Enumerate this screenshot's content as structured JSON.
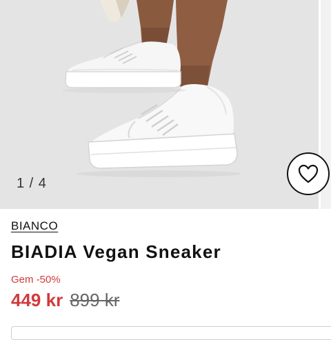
{
  "gallery": {
    "counter": "1 / 4",
    "image_alt": "White vegan leather sneakers worn on feet",
    "wishlist_icon": "heart-outline-icon"
  },
  "product": {
    "brand": "BIANCO",
    "title": "BIADIA Vegan Sneaker",
    "discount": "Gem -50%",
    "sale_price": "449 kr",
    "original_price": "899 kr"
  },
  "colors": {
    "sale": "#d23a3a",
    "image_background": "#e4e4e4",
    "text": "#111111"
  }
}
